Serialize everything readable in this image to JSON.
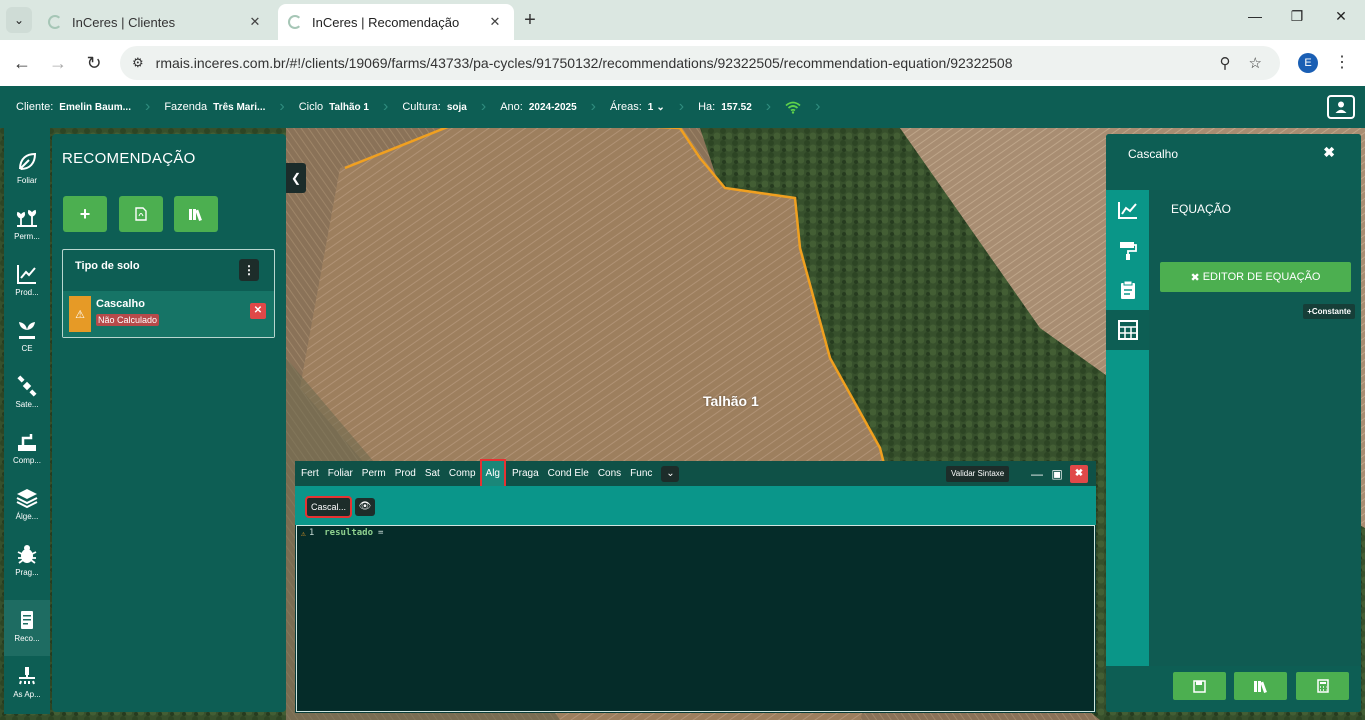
{
  "browser": {
    "tabs": [
      {
        "title": "InCeres | Clientes"
      },
      {
        "title": "InCeres | Recomendação"
      }
    ],
    "url": "rmais.inceres.com.br/#!/clients/19069/farms/43733/pa-cycles/91750132/recommendations/92322505/recommendation-equation/92322508",
    "profile_initial": "E"
  },
  "header": {
    "crumbs": [
      {
        "key": "Cliente:",
        "value": "Emelin Baum..."
      },
      {
        "key": "Fazenda",
        "value": "Três Mari..."
      },
      {
        "key": "Ciclo",
        "value": "Talhão 1"
      },
      {
        "key": "Cultura:",
        "value": "soja"
      },
      {
        "key": "Ano:",
        "value": "2024-2025"
      },
      {
        "key": "Áreas:",
        "value": "1"
      },
      {
        "key": "Ha:",
        "value": "157.52"
      }
    ]
  },
  "rail": {
    "items": [
      {
        "label": "Foliar",
        "icon": "leaf-icon"
      },
      {
        "label": "Perm...",
        "icon": "plants-icon"
      },
      {
        "label": "Prod...",
        "icon": "trend-chart-icon"
      },
      {
        "label": "CE",
        "icon": "sprout-icon"
      },
      {
        "label": "Sate...",
        "icon": "satellite-icon"
      },
      {
        "label": "Comp...",
        "icon": "compaction-icon"
      },
      {
        "label": "Álge...",
        "icon": "layers-icon"
      },
      {
        "label": "Prag...",
        "icon": "bug-icon"
      },
      {
        "label": "Reco...",
        "icon": "document-icon"
      },
      {
        "label": "As Ap...",
        "icon": "sprayer-icon"
      }
    ]
  },
  "recommendation": {
    "title": "RECOMENDAÇÃO",
    "soil_header": "Tipo de solo",
    "item_name": "Cascalho",
    "item_status": "Não Calculado"
  },
  "map": {
    "field_label": "Talhão 1"
  },
  "right_panel": {
    "title": "Cascalho",
    "section_label": "EQUAÇÃO",
    "editor_button": "EDITOR DE EQUAÇÃO",
    "constant_button": "Constante"
  },
  "editor": {
    "menus": [
      "Fert",
      "Foliar",
      "Perm",
      "Prod",
      "Sat",
      "Comp",
      "Alg",
      "Praga",
      "Cond Ele",
      "Cons",
      "Func"
    ],
    "active_menu": "Alg",
    "validate_label": "Validar Sintaxe",
    "chip_label": "Cascal...",
    "line_number": "1",
    "code_keyword": "resultado",
    "code_operator": "="
  },
  "colors": {
    "primary": "#0d5e54",
    "teal": "#0a968a",
    "green_button": "#4caf50",
    "danger": "#e04848",
    "warning": "#e69a26",
    "field_outline": "#f0a020"
  }
}
